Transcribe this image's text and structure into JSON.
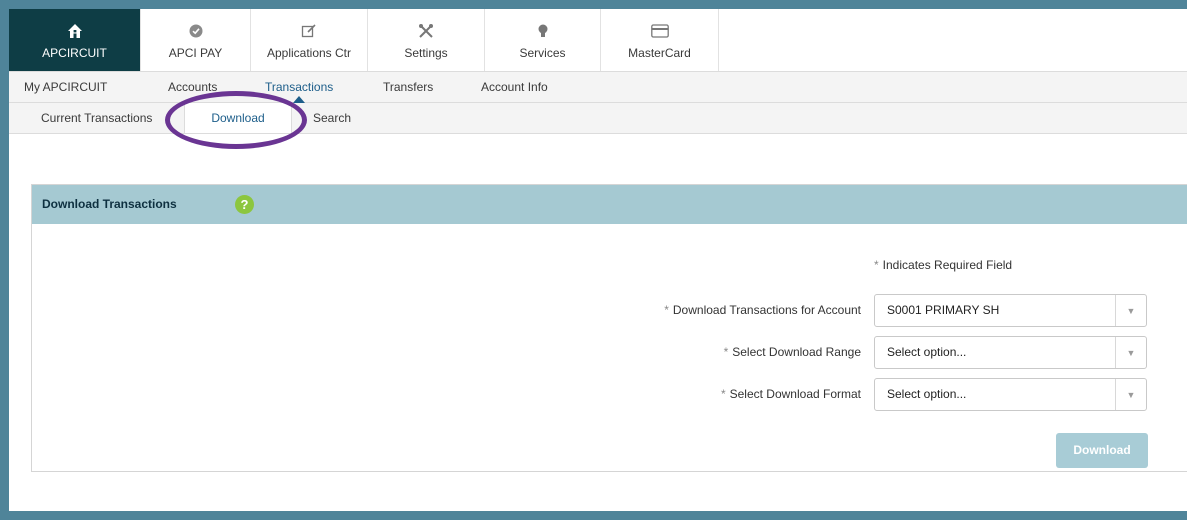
{
  "top_nav": {
    "items": [
      {
        "label": "APCIRCUIT",
        "icon": "home-icon"
      },
      {
        "label": "APCI PAY",
        "icon": "check-circle-icon"
      },
      {
        "label": "Applications Ctr",
        "icon": "edit-icon"
      },
      {
        "label": "Settings",
        "icon": "tools-icon"
      },
      {
        "label": "Services",
        "icon": "bulb-icon"
      },
      {
        "label": "MasterCard",
        "icon": "card-icon"
      }
    ]
  },
  "sub_nav": {
    "items": [
      {
        "label": "My APCIRCUIT"
      },
      {
        "label": "Accounts"
      },
      {
        "label": "Transactions"
      },
      {
        "label": "Transfers"
      },
      {
        "label": "Account Info"
      }
    ]
  },
  "third_nav": {
    "items": [
      {
        "label": "Current Transactions"
      },
      {
        "label": "Download"
      },
      {
        "label": "Search"
      }
    ]
  },
  "panel": {
    "title": "Download Transactions",
    "help_icon": "?",
    "required_note": "Indicates Required Field",
    "required_star": "*",
    "fields": [
      {
        "label": "Download Transactions for Account",
        "value": "S0001 PRIMARY SH"
      },
      {
        "label": "Select Download Range",
        "value": "Select option..."
      },
      {
        "label": "Select Download Format",
        "value": "Select option..."
      }
    ],
    "download_button": "Download"
  },
  "colors": {
    "frame": "#4f8499",
    "active_nav": "#0e3d45",
    "panel_header": "#a5c9d2",
    "highlight": "#6a3593",
    "help_icon": "#8cc63f",
    "button": "#a8ccd6"
  }
}
